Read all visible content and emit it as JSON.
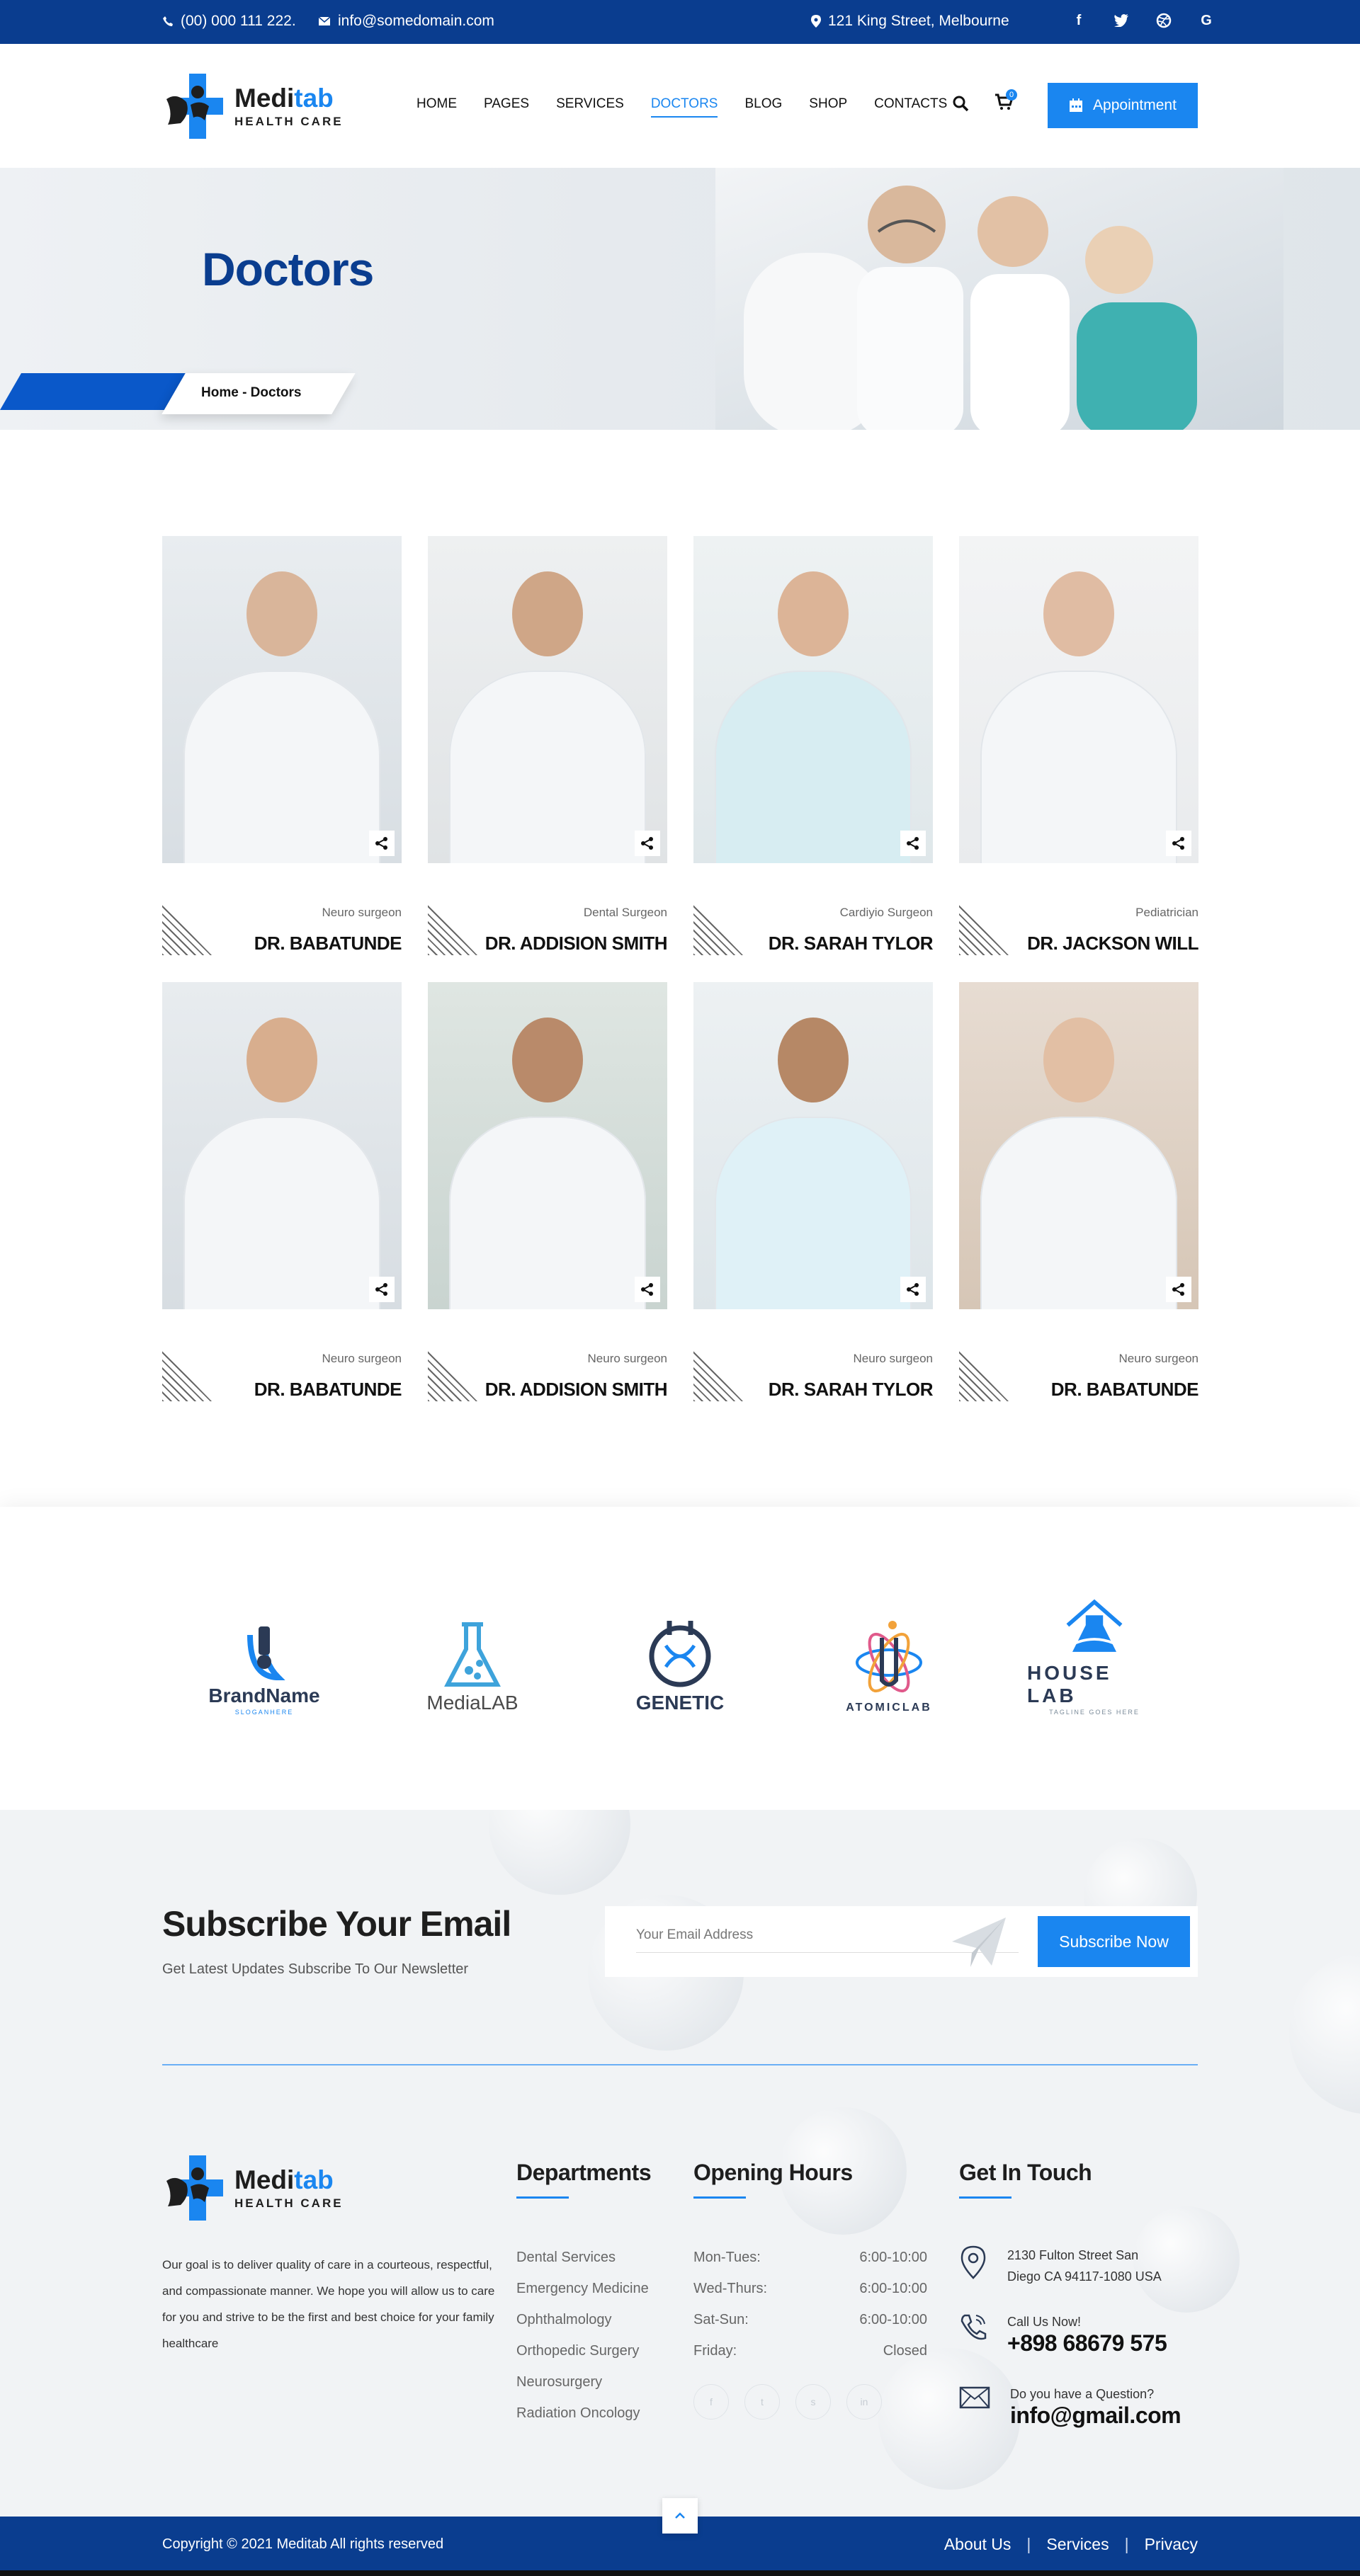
{
  "topbar": {
    "phone": "(00) 000 111 222.",
    "email": "info@somedomain.com",
    "address": "121 King Street, Melbourne",
    "social_icons": [
      "facebook-icon",
      "twitter-icon",
      "dribbble-icon",
      "google-icon"
    ]
  },
  "brand": {
    "name_prefix": "Medi",
    "name_suffix": "tab",
    "tagline": "HEALTH CARE"
  },
  "nav": {
    "items": [
      "HOME",
      "PAGES",
      "SERVICES",
      "DOCTORS",
      "BLOG",
      "SHOP",
      "CONTACTS"
    ],
    "active": "DOCTORS",
    "cart_count": "0",
    "appointment_label": "Appointment"
  },
  "hero": {
    "title": "Doctors",
    "breadcrumb": "Home  -  Doctors"
  },
  "doctors": [
    {
      "role": "Neuro surgeon",
      "name": "DR. BABATUNDE"
    },
    {
      "role": "Dental Surgeon",
      "name": "DR. ADDISION SMITH"
    },
    {
      "role": "Cardiyio Surgeon",
      "name": "DR. SARAH TYLOR"
    },
    {
      "role": "Pediatrician",
      "name": "DR. JACKSON WILL"
    },
    {
      "role": "Neuro surgeon",
      "name": "DR. BABATUNDE"
    },
    {
      "role": "Neuro surgeon",
      "name": "DR. ADDISION SMITH"
    },
    {
      "role": "Neuro surgeon",
      "name": "DR. SARAH TYLOR"
    },
    {
      "role": "Neuro surgeon",
      "name": "DR. BABATUNDE"
    }
  ],
  "partners": [
    {
      "name": "BrandName",
      "tag": "SLOGANHERE"
    },
    {
      "name": "MediaLAB",
      "tag": ""
    },
    {
      "name": "GENETIC",
      "tag": ""
    },
    {
      "name": "ATOMICLAB",
      "tag": ""
    },
    {
      "name": "HOUSE LAB",
      "tag": "TAGLINE GOES HERE"
    }
  ],
  "subscribe": {
    "title": "Subscribe Your Email",
    "description": "Get Latest Updates Subscribe To Our Newsletter",
    "placeholder": "Your Email Address",
    "button": "Subscribe Now"
  },
  "footer": {
    "about": "Our goal is to deliver quality of care in a courteous, respectful, and compassionate manner. We hope you will allow us to care for you and strive to be the first and best choice for your family healthcare",
    "departments_title": "Departments",
    "departments": [
      "Dental Services",
      "Emergency Medicine",
      "Ophthalmology",
      "Orthopedic Surgery",
      "Neurosurgery",
      "Radiation Oncology"
    ],
    "hours_title": "Opening Hours",
    "hours": [
      {
        "day": "Mon-Tues:",
        "time": "6:00-10:00"
      },
      {
        "day": "Wed-Thurs:",
        "time": "6:00-10:00"
      },
      {
        "day": "Sat-Sun:",
        "time": "6:00-10:00"
      },
      {
        "day": "Friday:",
        "time": "Closed"
      }
    ],
    "contact_title": "Get In Touch",
    "address_line1": "2130 Fulton Street San",
    "address_line2": "Diego CA 94117-1080 USA",
    "call_label": "Call Us Now!",
    "phone": "+898 68679 575",
    "question_label": "Do you have a Question?",
    "email": "info@gmail.com"
  },
  "bottombar": {
    "copyright": "Copyright © 2021 Meditab All rights reserved",
    "links": [
      "About Us",
      "Services",
      "Privacy"
    ]
  },
  "colors": {
    "primary_dark": "#0a3d8f",
    "accent": "#1a86f0"
  }
}
